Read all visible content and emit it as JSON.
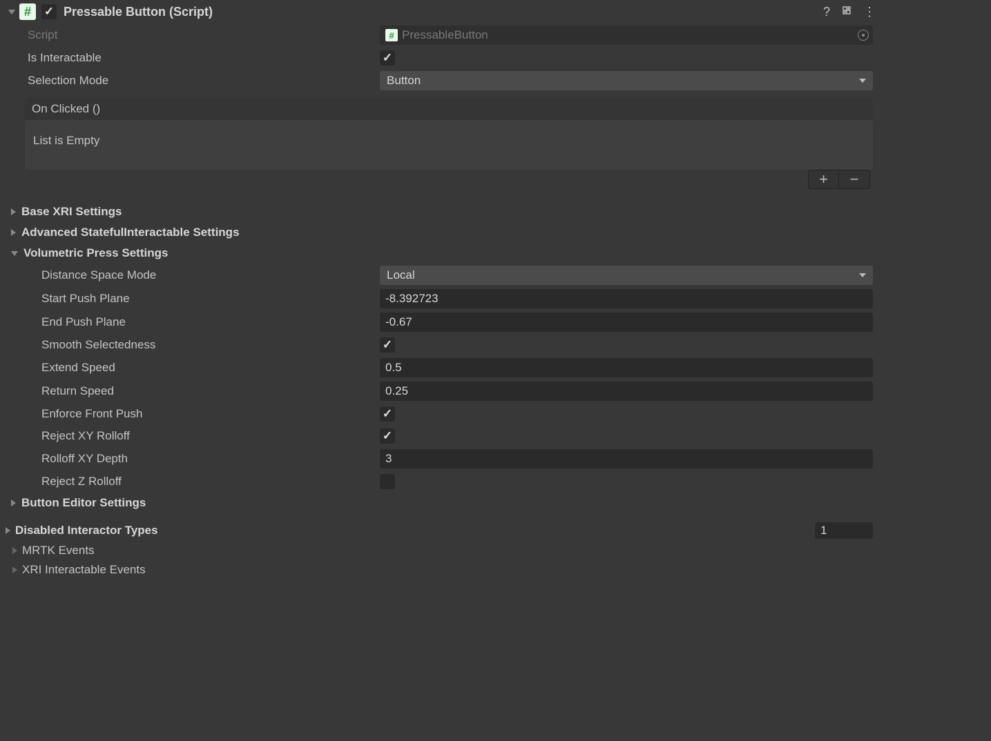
{
  "header": {
    "title": "Pressable Button (Script)"
  },
  "fields": {
    "script": {
      "label": "Script",
      "value": "PressableButton"
    },
    "isInteractable": {
      "label": "Is Interactable",
      "value": true
    },
    "selectionMode": {
      "label": "Selection Mode",
      "value": "Button"
    }
  },
  "events": {
    "onClicked": {
      "label": "On Clicked ()",
      "empty_text": "List is Empty"
    }
  },
  "sections": {
    "baseXRI": "Base XRI Settings",
    "advancedStateful": "Advanced StatefulInteractable Settings",
    "volumetric": "Volumetric Press Settings",
    "buttonEditor": "Button Editor Settings",
    "disabledInteractor": {
      "label": "Disabled Interactor Types",
      "count": "1"
    },
    "mrtkEvents": "MRTK Events",
    "xriEvents": "XRI Interactable Events"
  },
  "volumetric": {
    "distanceSpaceMode": {
      "label": "Distance Space Mode",
      "value": "Local"
    },
    "startPushPlane": {
      "label": "Start Push Plane",
      "value": "-8.392723"
    },
    "endPushPlane": {
      "label": "End Push Plane",
      "value": "-0.67"
    },
    "smoothSelectedness": {
      "label": "Smooth Selectedness",
      "value": true
    },
    "extendSpeed": {
      "label": "Extend Speed",
      "value": "0.5"
    },
    "returnSpeed": {
      "label": "Return Speed",
      "value": "0.25"
    },
    "enforceFrontPush": {
      "label": "Enforce Front Push",
      "value": true
    },
    "rejectXYRolloff": {
      "label": "Reject XY Rolloff",
      "value": true
    },
    "rolloffXYDepth": {
      "label": "Rolloff XY Depth",
      "value": "3"
    },
    "rejectZRolloff": {
      "label": "Reject Z Rolloff",
      "value": false
    }
  }
}
